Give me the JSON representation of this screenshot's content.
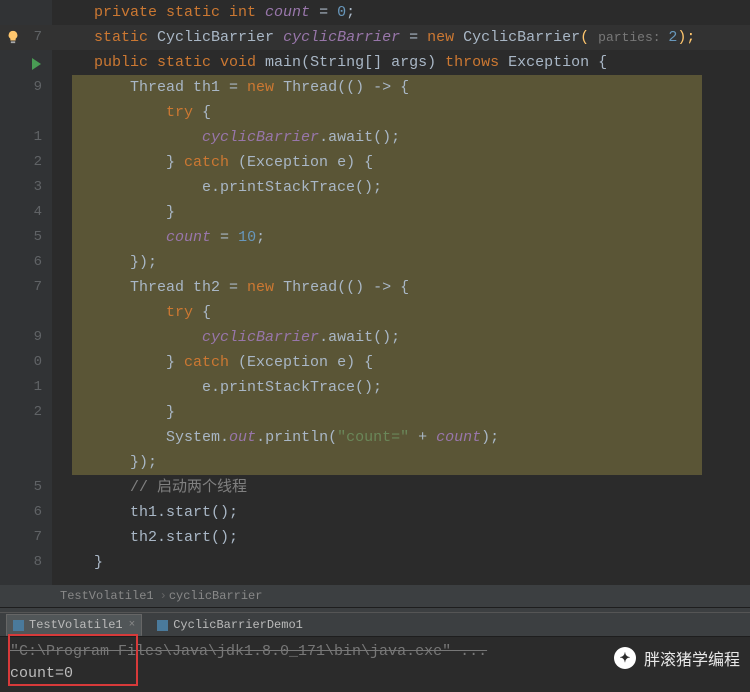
{
  "gutter": [
    "",
    "7",
    "",
    "9",
    "",
    "1",
    "2",
    "3",
    "4",
    "5",
    "6",
    "7",
    "",
    "9",
    "0",
    "1",
    "2",
    "",
    "",
    "5",
    "6",
    "7",
    "8",
    ""
  ],
  "code": {
    "l0": {
      "pre": "    ",
      "k1": "private static int ",
      "v": "count",
      "eq": " = ",
      "n": "0",
      "end": ";"
    },
    "l1": {
      "pre": "    ",
      "k1": "static ",
      "cls": "CyclicBarrier ",
      "v": "cyclicBarrier",
      "eq": " = ",
      "k2": "new ",
      "cls2": "CyclicBarrier",
      "op": "( ",
      "hint": "parties: ",
      "n": "2",
      "cl": ");"
    },
    "l2": {
      "pre": "    ",
      "k1": "public static void ",
      "m": "main",
      "sig": "(String[] args) ",
      "k2": "throws ",
      "ex": "Exception {"
    },
    "l3": {
      "pre": "        ",
      "txt": "Thread th1 = ",
      "k": "new ",
      "rest": "Thread(() -> {"
    },
    "l4": {
      "pre": "            ",
      "k": "try ",
      "b": "{"
    },
    "l5": {
      "pre": "                ",
      "v": "cyclicBarrier",
      "call": ".await();"
    },
    "l6": {
      "pre": "            } ",
      "k": "catch ",
      "rest": "(Exception e) {"
    },
    "l7": {
      "pre": "                ",
      "txt": "e.printStackTrace();"
    },
    "l8": {
      "pre": "            ",
      "txt": "}"
    },
    "l9": {
      "pre": "            ",
      "v": "count",
      "eq": " = ",
      "n": "10",
      "end": ";"
    },
    "l10": {
      "pre": "        ",
      "txt": "});"
    },
    "l11": {
      "pre": "        ",
      "txt": "Thread th2 = ",
      "k": "new ",
      "rest": "Thread(() -> {"
    },
    "l12": {
      "pre": "            ",
      "k": "try ",
      "b": "{"
    },
    "l13": {
      "pre": "                ",
      "v": "cyclicBarrier",
      "call": ".await();"
    },
    "l14": {
      "pre": "            } ",
      "k": "catch ",
      "rest": "(Exception e) {"
    },
    "l15": {
      "pre": "                ",
      "txt": "e.printStackTrace();"
    },
    "l16": {
      "pre": "            ",
      "txt": "}"
    },
    "l17": {
      "pre": "            ",
      "txt": "System.",
      "v": "out",
      "p": ".println(",
      "s": "\"count=\"",
      "plus": " + ",
      "v2": "count",
      "end": ");"
    },
    "l18": {
      "pre": "        ",
      "txt": "});"
    },
    "l19": {
      "pre": "        ",
      "c": "// 启动两个线程"
    },
    "l20": {
      "pre": "        ",
      "txt": "th1.start();"
    },
    "l21": {
      "pre": "        ",
      "txt": "th2.start();"
    },
    "l22": {
      "pre": "    ",
      "txt": "}"
    }
  },
  "breadcrumbs": {
    "a": "TestVolatile1",
    "b": "cyclicBarrier"
  },
  "run_tabs": {
    "t1": "TestVolatile1",
    "t2": "CyclicBarrierDemo1"
  },
  "console": {
    "l1": "\"C:\\Program Files\\Java\\jdk1.8.0_171\\bin\\java.exe\" ...",
    "l2": "count=0"
  },
  "watermark": "胖滚猪学编程"
}
